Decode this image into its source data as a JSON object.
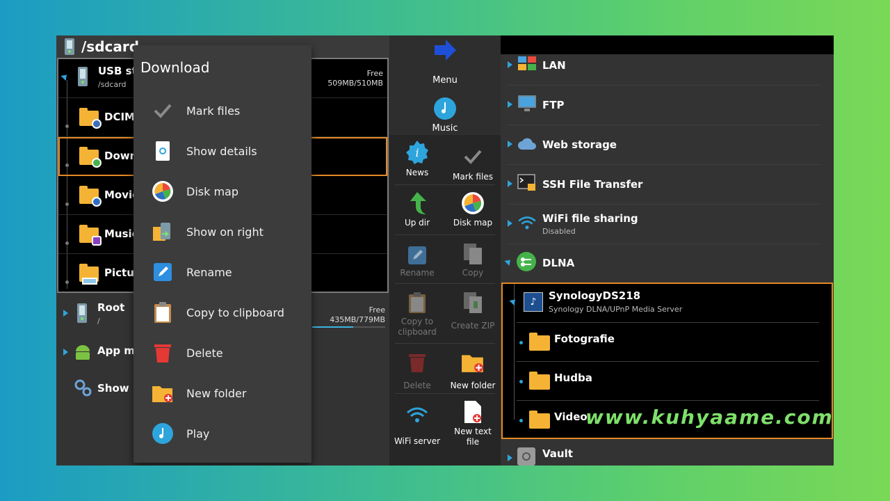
{
  "left": {
    "path": "/sdcard",
    "items": [
      {
        "label": "USB sto",
        "sub": "/sdcard",
        "free_label": "Free",
        "free_value": "509MB/510MB",
        "usage": 0.998
      },
      {
        "label": "DCIM"
      },
      {
        "label": "Downl"
      },
      {
        "label": "Movie"
      },
      {
        "label": "Music"
      },
      {
        "label": "Pictur"
      }
    ],
    "root": {
      "label": "Root",
      "sub": "/",
      "free_label": "Free",
      "free_value": "435MB/779MB",
      "usage": 0.56
    },
    "app_manager": "App ma",
    "show": "Show"
  },
  "context_menu": {
    "title": "Download",
    "items": [
      {
        "label": "Mark files",
        "icon": "checkmark-icon"
      },
      {
        "label": "Show details",
        "icon": "details-icon"
      },
      {
        "label": "Disk map",
        "icon": "disk-map-icon"
      },
      {
        "label": "Show on right",
        "icon": "show-on-right-icon"
      },
      {
        "label": "Rename",
        "icon": "rename-icon"
      },
      {
        "label": "Copy to clipboard",
        "icon": "clipboard-icon"
      },
      {
        "label": "Delete",
        "icon": "trash-icon"
      },
      {
        "label": "New folder",
        "icon": "new-folder-icon"
      },
      {
        "label": "Play",
        "icon": "play-music-icon"
      }
    ]
  },
  "toolbar": {
    "menu": "Menu",
    "music": "Music",
    "tools": [
      {
        "label": "News",
        "enabled": true
      },
      {
        "label": "Mark files",
        "enabled": true
      },
      {
        "label": "Up dir",
        "enabled": true
      },
      {
        "label": "Disk map",
        "enabled": true
      },
      {
        "label": "Rename",
        "enabled": false
      },
      {
        "label": "Copy",
        "enabled": false
      },
      {
        "label": "Copy to clipboard",
        "enabled": false
      },
      {
        "label": "Create ZIP",
        "enabled": false
      },
      {
        "label": "Delete",
        "enabled": false
      },
      {
        "label": "New folder",
        "enabled": true
      },
      {
        "label": "WiFi server",
        "enabled": true
      },
      {
        "label": "New text file",
        "enabled": true
      }
    ]
  },
  "right": {
    "items": [
      {
        "label": "LAN"
      },
      {
        "label": "FTP"
      },
      {
        "label": "Web storage"
      },
      {
        "label": "SSH File Transfer"
      },
      {
        "label": "WiFi file sharing",
        "sub": "Disabled"
      },
      {
        "label": "DLNA"
      }
    ],
    "server": {
      "label": "SynologyDS218",
      "sub": "Synology DLNA/UPnP Media Server"
    },
    "folders": [
      "Fotografie",
      "Hudba",
      "Video"
    ],
    "vault": "Vault"
  },
  "watermark": "www.kuhyaame.com",
  "colors": {
    "accent": "#2ea4dc",
    "selection": "#e58a24",
    "folder": "#f5b335"
  }
}
